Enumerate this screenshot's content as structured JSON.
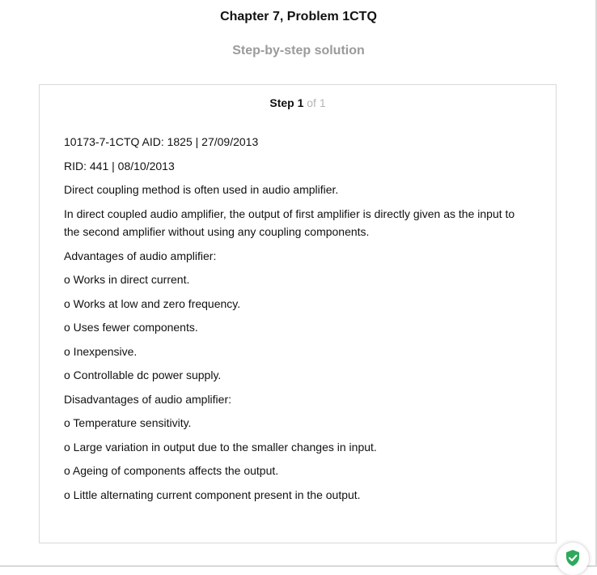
{
  "header": {
    "title": "Chapter 7, Problem 1CTQ",
    "subtitle": "Step-by-step solution"
  },
  "step": {
    "label": "Step 1",
    "of": "of 1"
  },
  "content": {
    "lines": [
      "10173-7-1CTQ AID: 1825 | 27/09/2013",
      "RID: 441 | 08/10/2013",
      "Direct coupling method is often used in audio amplifier.",
      "In direct coupled audio amplifier, the output of first amplifier is directly given as the input to the second amplifier without using any coupling components.",
      "Advantages of audio amplifier:",
      "o Works in direct current.",
      "o Works at low and zero frequency.",
      "o Uses fewer components.",
      "o Inexpensive.",
      "o Controllable dc power supply.",
      "Disadvantages of audio amplifier:",
      "o Temperature sensitivity.",
      "o Large variation in output due to the smaller changes in input.",
      "o Ageing of components affects the output.",
      "o Little alternating current component present in the output."
    ]
  },
  "badge": {
    "icon": "shield-check-icon",
    "color": "#2eaa5c"
  }
}
